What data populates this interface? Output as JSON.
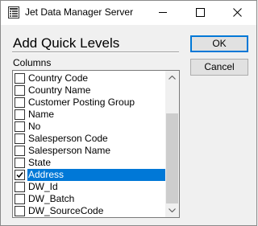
{
  "window": {
    "title": "Jet Data Manager Server",
    "icon": "app-grid-icon",
    "caption_buttons": [
      "minimize-icon",
      "maximize-icon",
      "close-icon"
    ]
  },
  "dialog": {
    "heading": "Add Quick Levels",
    "columns_label": "Columns"
  },
  "buttons": {
    "ok_label": "OK",
    "cancel_label": "Cancel"
  },
  "columns": {
    "items": [
      {
        "label": "Country Code",
        "checked": false,
        "selected": false
      },
      {
        "label": "Country Name",
        "checked": false,
        "selected": false
      },
      {
        "label": "Customer Posting Group",
        "checked": false,
        "selected": false
      },
      {
        "label": "Name",
        "checked": false,
        "selected": false
      },
      {
        "label": "No",
        "checked": false,
        "selected": false
      },
      {
        "label": "Salesperson Code",
        "checked": false,
        "selected": false
      },
      {
        "label": "Salesperson Name",
        "checked": false,
        "selected": false
      },
      {
        "label": "State",
        "checked": false,
        "selected": false
      },
      {
        "label": "Address",
        "checked": true,
        "selected": true
      },
      {
        "label": "DW_Id",
        "checked": false,
        "selected": false
      },
      {
        "label": "DW_Batch",
        "checked": false,
        "selected": false
      },
      {
        "label": "DW_SourceCode",
        "checked": false,
        "selected": false
      }
    ]
  },
  "colors": {
    "selection": "#0078d7",
    "window_bg": "#f0f0f0"
  }
}
